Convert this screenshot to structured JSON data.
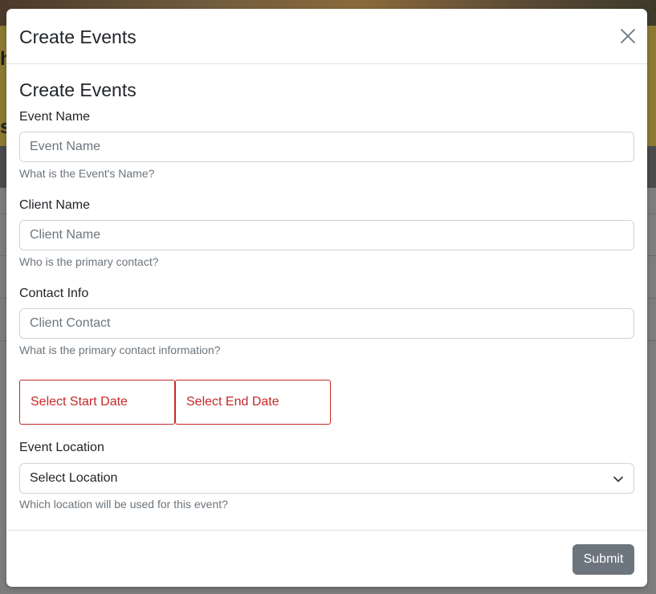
{
  "background": {
    "fragment_1": "h",
    "fragment_2": "s"
  },
  "modal": {
    "title": "Create Events",
    "close_icon": "close-icon"
  },
  "form": {
    "heading": "Create Events",
    "event_name": {
      "label": "Event Name",
      "placeholder": "Event Name",
      "help": "What is the Event's Name?"
    },
    "client_name": {
      "label": "Client Name",
      "placeholder": "Client Name",
      "help": "Who is the primary contact?"
    },
    "contact_info": {
      "label": "Contact Info",
      "placeholder": "Client Contact",
      "help": "What is the primary contact information?"
    },
    "start_date_label": "Select Start Date",
    "end_date_label": "Select End Date",
    "location": {
      "label": "Event Location",
      "selected": "Select Location",
      "help": "Which location will be used for this event?"
    }
  },
  "footer": {
    "submit_label": "Submit"
  },
  "colors": {
    "date_button_accent": "#c62828",
    "submit_bg": "#6c757d"
  }
}
